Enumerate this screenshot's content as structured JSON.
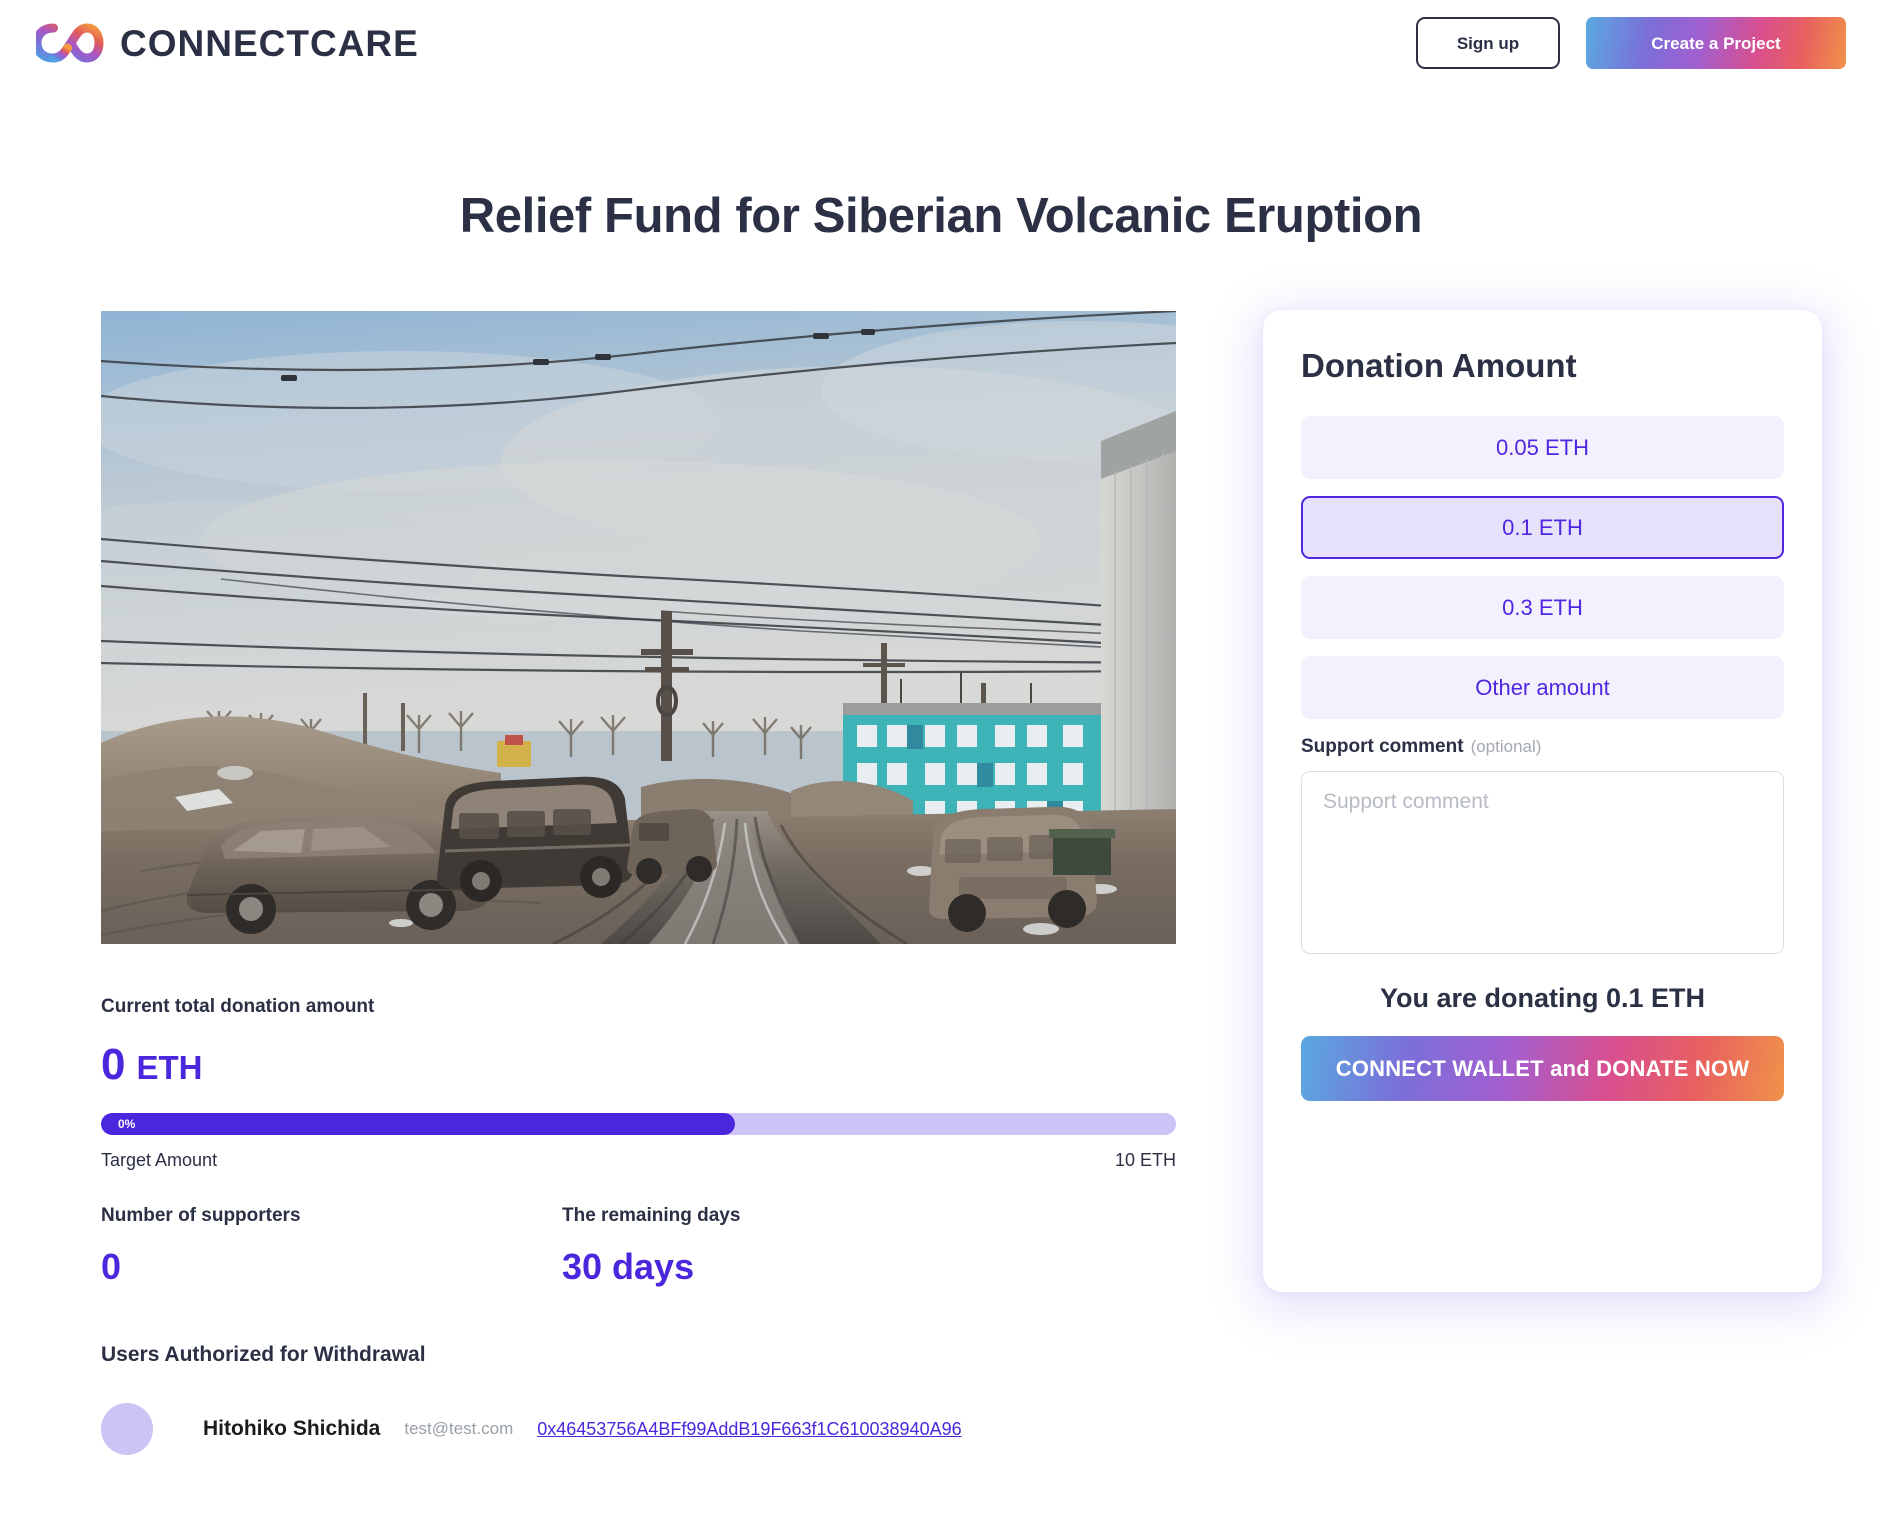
{
  "header": {
    "brand_name": "CONNECTCARE",
    "logo_icon": "infinity-gradient-logo",
    "signup_label": "Sign up",
    "create_project_label": "Create a Project"
  },
  "project": {
    "title": "Relief Fund for Siberian Volcanic Eruption",
    "hero_image_alt": "Street covered in volcanic ash with buried cars, power lines and a teal apartment block"
  },
  "stats": {
    "total_label": "Current total donation amount",
    "total_value": "0",
    "total_unit": "ETH",
    "progress_percent_label": "0%",
    "progress_fill_ratio": 59,
    "target_label": "Target Amount",
    "target_value": "10 ETH",
    "supporters_label": "Number of supporters",
    "supporters_value": "0",
    "remaining_label": "The remaining days",
    "remaining_value": "30 days"
  },
  "withdrawal": {
    "section_title": "Users Authorized for Withdrawal",
    "users": [
      {
        "avatar": "user-avatar",
        "name": "Hitohiko Shichida",
        "email": "test@test.com",
        "wallet": "0x46453756A4BFf99AddB19F663f1C610038940A96"
      }
    ]
  },
  "donation": {
    "panel_title": "Donation Amount",
    "options": [
      {
        "label": "0.05 ETH",
        "selected": false
      },
      {
        "label": "0.1 ETH",
        "selected": true
      },
      {
        "label": "0.3 ETH",
        "selected": false
      },
      {
        "label": "Other amount",
        "selected": false
      }
    ],
    "comment_label": "Support comment",
    "comment_optional": "(optional)",
    "comment_placeholder": "Support comment",
    "comment_value": "",
    "summary": "You are donating 0.1 ETH",
    "cta_label": "CONNECT WALLET and DONATE NOW"
  },
  "colors": {
    "accent_purple": "#4a26dd",
    "option_purple": "#5027e0",
    "text_dark": "#2b3044",
    "muted": "#9aa0a8",
    "track_light": "#cfc4f7"
  }
}
